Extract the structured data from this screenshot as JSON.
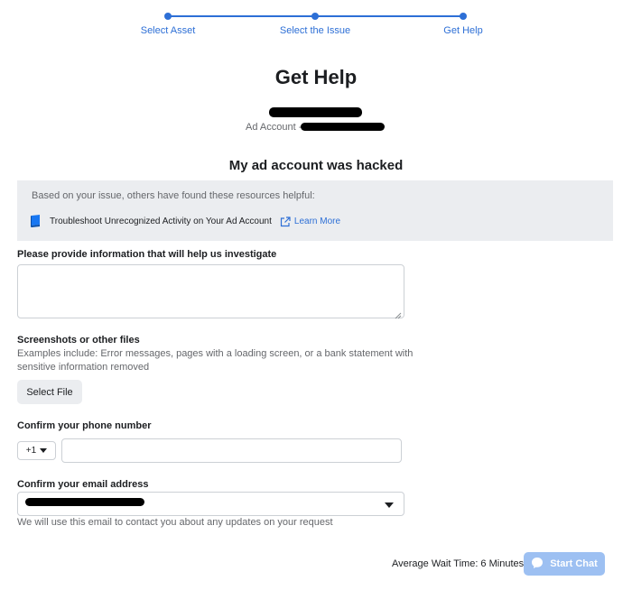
{
  "stepper": {
    "steps": [
      {
        "label": "Select Asset"
      },
      {
        "label": "Select the Issue"
      },
      {
        "label": "Get Help"
      }
    ]
  },
  "page": {
    "title": "Get Help",
    "account_prefix": "Ad Account -",
    "issue_title": "My ad account was hacked"
  },
  "resources": {
    "intro": "Based on your issue, others have found these resources helpful:",
    "items": [
      {
        "title": "Troubleshoot Unrecognized Activity on Your Ad Account",
        "link_label": "Learn More"
      }
    ]
  },
  "form": {
    "investigate_label": "Please provide information that will help us investigate",
    "investigate_value": "",
    "files_label": "Screenshots or other files",
    "files_help_line1": "Examples include: Error messages, pages with a loading screen, or a bank statement with",
    "files_help_line2": "sensitive information removed",
    "select_file_label": "Select File",
    "phone_label": "Confirm your phone number",
    "phone_country_code": "+1",
    "phone_value": "",
    "email_label": "Confirm your email address",
    "email_help": "We will use this email to contact you about any updates on your request"
  },
  "chat": {
    "wait_time": "Average Wait Time: 6 Minutes",
    "start_chat_label": "Start Chat"
  },
  "colors": {
    "accent": "#2d6fd6",
    "panel_bg": "#ebedf0",
    "chat_button": "#9dc0f2"
  }
}
